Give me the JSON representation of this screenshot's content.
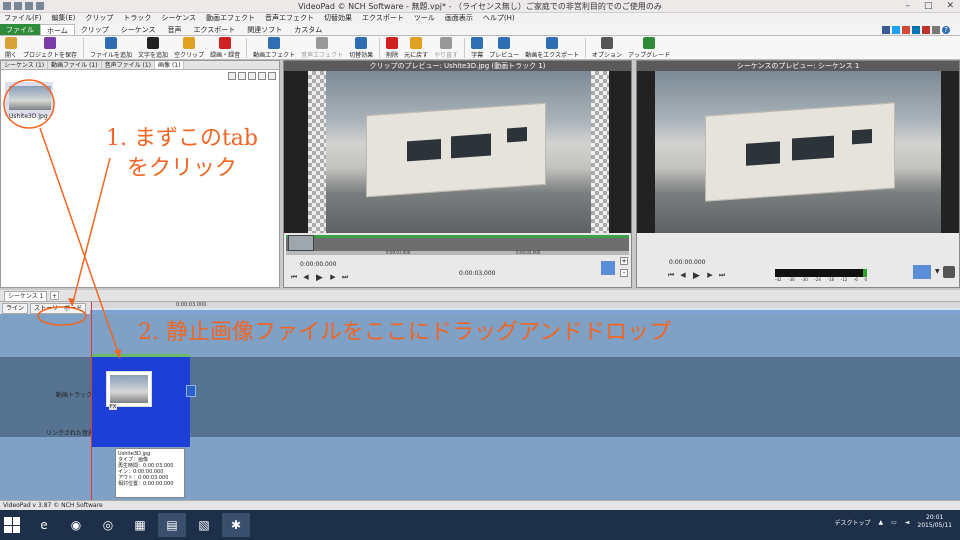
{
  "window": {
    "title": "VideoPad © NCH Software - 無題.vpj* - （ライセンス無し）ご家庭での非営利目的でのご使用のみ",
    "min": "–",
    "max": "□",
    "close": "✕"
  },
  "menu": [
    "ファイル(F)",
    "編集(E)",
    "クリップ",
    "トラック",
    "シーケンス",
    "動画エフェクト",
    "音声エフェクト",
    "切替効果",
    "エクスポート",
    "ツール",
    "画面表示",
    "ヘルプ(H)"
  ],
  "ribbon_tabs": [
    "ファイル",
    "ホーム",
    "クリップ",
    "シーケンス",
    "音声",
    "エクスポート",
    "関連ソフト",
    "カスタム"
  ],
  "help_icon": "?",
  "toolbar": [
    {
      "label": "開く",
      "icon": "folder-icon",
      "color": "#d8a23a"
    },
    {
      "label": "プロジェクトを保存",
      "icon": "save-icon",
      "color": "#7a3aa8"
    },
    {
      "label": "ファイルを追加",
      "icon": "add-file-icon",
      "color": "#2f6db5"
    },
    {
      "label": "文字を追加",
      "icon": "text-icon",
      "color": "#222222"
    },
    {
      "label": "空クリップ",
      "icon": "blank-clip-icon",
      "color": "#e0a020"
    },
    {
      "label": "録画・録音",
      "icon": "record-icon",
      "color": "#d02020"
    },
    {
      "label": "動画エフェクト",
      "icon": "fx-icon",
      "color": "#2f6db5"
    },
    {
      "label": "音声エフェクト",
      "icon": "audio-fx-icon",
      "color": "#999999",
      "disabled": true
    },
    {
      "label": "切替効果",
      "icon": "transition-icon",
      "color": "#2f6db5"
    },
    {
      "label": "削除",
      "icon": "delete-icon",
      "color": "#d02020"
    },
    {
      "label": "元に戻す",
      "icon": "undo-icon",
      "color": "#e0a020"
    },
    {
      "label": "やり直す",
      "icon": "redo-icon",
      "color": "#999999",
      "disabled": true
    },
    {
      "label": "字幕",
      "icon": "subtitle-icon",
      "color": "#2f6db5"
    },
    {
      "label": "プレビュー",
      "icon": "preview-icon",
      "color": "#2f6db5"
    },
    {
      "label": "動画をエクスポート",
      "icon": "export-icon",
      "color": "#2f6db5"
    },
    {
      "label": "オプション",
      "icon": "options-icon",
      "color": "#555555"
    },
    {
      "label": "アップグレード",
      "icon": "upgrade-icon",
      "color": "#2e8b3a"
    }
  ],
  "bin": {
    "tabs": [
      {
        "label": "シーケンス",
        "count": "(1)"
      },
      {
        "label": "動画ファイル",
        "count": "(1)"
      },
      {
        "label": "音声ファイル",
        "count": "(1)"
      },
      {
        "label": "画像",
        "count": "(1)"
      }
    ],
    "item_label": "Ushite3D.jpg"
  },
  "clip_preview": {
    "title": "クリップのプレビュー: Ushite3D.jpg (動画トラック 1)",
    "time_current": "0:00:00.000",
    "time_total": "0:00:03.000",
    "tick1": "0:00:01.000",
    "tick2": "0:00:02.000"
  },
  "seq_preview": {
    "title": "シーケンスのプレビュー: シーケンス 1",
    "time_current": "0:00:00.000",
    "meter_labels": [
      "-42",
      "-36",
      "-30",
      "-24",
      "-18",
      "-12",
      "-6",
      "0"
    ]
  },
  "sequence": {
    "tab": "シーケンス 1",
    "add": "+"
  },
  "timeline": {
    "view_tabs": [
      "ライン",
      "ストーリーボード"
    ],
    "ruler_time": "0:00:03.000",
    "track_video": "動画トラック 1",
    "track_audio": "リンクされた音声",
    "clip_fx": "FX",
    "tooltip": [
      "Ushite3D.jpg",
      "タイプ：画像",
      "再生時間：0:00:03.000",
      "イン：0:00:00.000",
      "アウト：0:00:03.000",
      "相対位置：0:00:00.000"
    ]
  },
  "status": "VideoPad v 3.87 © NCH Software",
  "taskbar": {
    "desktop": "デスクトップ",
    "time": "20:01",
    "date": "2015/05/11"
  },
  "annotations": {
    "step1_line1": "1. まずこのtab",
    "step1_line2": "をクリック",
    "step2": "2. 静止画像ファイルをここにドラッグアンドドロップ",
    "color": "#f26522"
  }
}
